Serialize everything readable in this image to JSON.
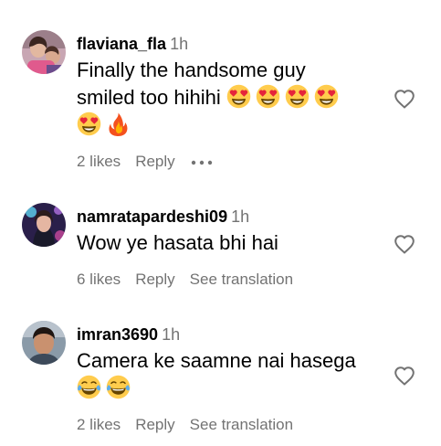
{
  "comments": [
    {
      "username": "flaviana_fla",
      "time": "1h",
      "text_line1": "Finally the handsome guy",
      "text_line2": "smiled too hihihi",
      "emojis": [
        "heart-eyes",
        "heart-eyes",
        "heart-eyes",
        "heart-eyes",
        "heart-eyes",
        "fire"
      ],
      "likes": "2 likes",
      "reply": "Reply",
      "more_icon": "ellipsis-icon",
      "heart_icon": "heart-outline-icon"
    },
    {
      "username": "namratapardeshi09",
      "time": "1h",
      "text_line1": "Wow ye hasata bhi hai",
      "likes": "6 likes",
      "reply": "Reply",
      "see_translation": "See translation",
      "heart_icon": "heart-outline-icon"
    },
    {
      "username": "imran3690",
      "time": "1h",
      "text_line1": "Camera ke saamne nai hasega",
      "emojis": [
        "tears-of-joy",
        "tears-of-joy"
      ],
      "likes": "2 likes",
      "reply": "Reply",
      "see_translation": "See translation",
      "heart_icon": "heart-outline-icon"
    }
  ],
  "colors": {
    "text": "#000000",
    "secondary": "#737373",
    "emoji_face": "#FFCC4D",
    "emoji_heart": "#E5243B",
    "fire": "#F4511E"
  }
}
